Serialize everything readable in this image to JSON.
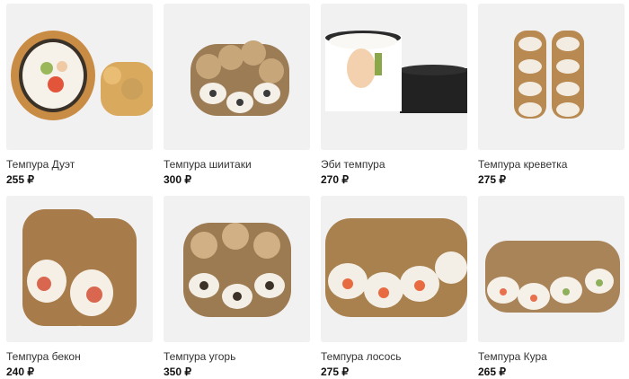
{
  "products": [
    {
      "name": "Темпура Дуэт",
      "price": "255 ₽",
      "icon": "tempura-roll-image"
    },
    {
      "name": "Темпура шиитаки",
      "price": "300 ₽",
      "icon": "tempura-roll-image"
    },
    {
      "name": "Эби темпура",
      "price": "270 ₽",
      "icon": "tempura-roll-image"
    },
    {
      "name": "Темпура креветка",
      "price": "275 ₽",
      "icon": "tempura-roll-image"
    },
    {
      "name": "Темпура бекон",
      "price": "240 ₽",
      "icon": "tempura-roll-image"
    },
    {
      "name": "Темпура угорь",
      "price": "350 ₽",
      "icon": "tempura-roll-image"
    },
    {
      "name": "Темпура лосось",
      "price": "275 ₽",
      "icon": "tempura-roll-image"
    },
    {
      "name": "Темпура Кура",
      "price": "265 ₽",
      "icon": "tempura-roll-image"
    }
  ],
  "colors": {
    "card_bg": "#efeff0",
    "crust": "#c79a5c",
    "rice": "#f7f4ee",
    "nori": "#2a2a2a",
    "salmon": "#e8784a"
  }
}
